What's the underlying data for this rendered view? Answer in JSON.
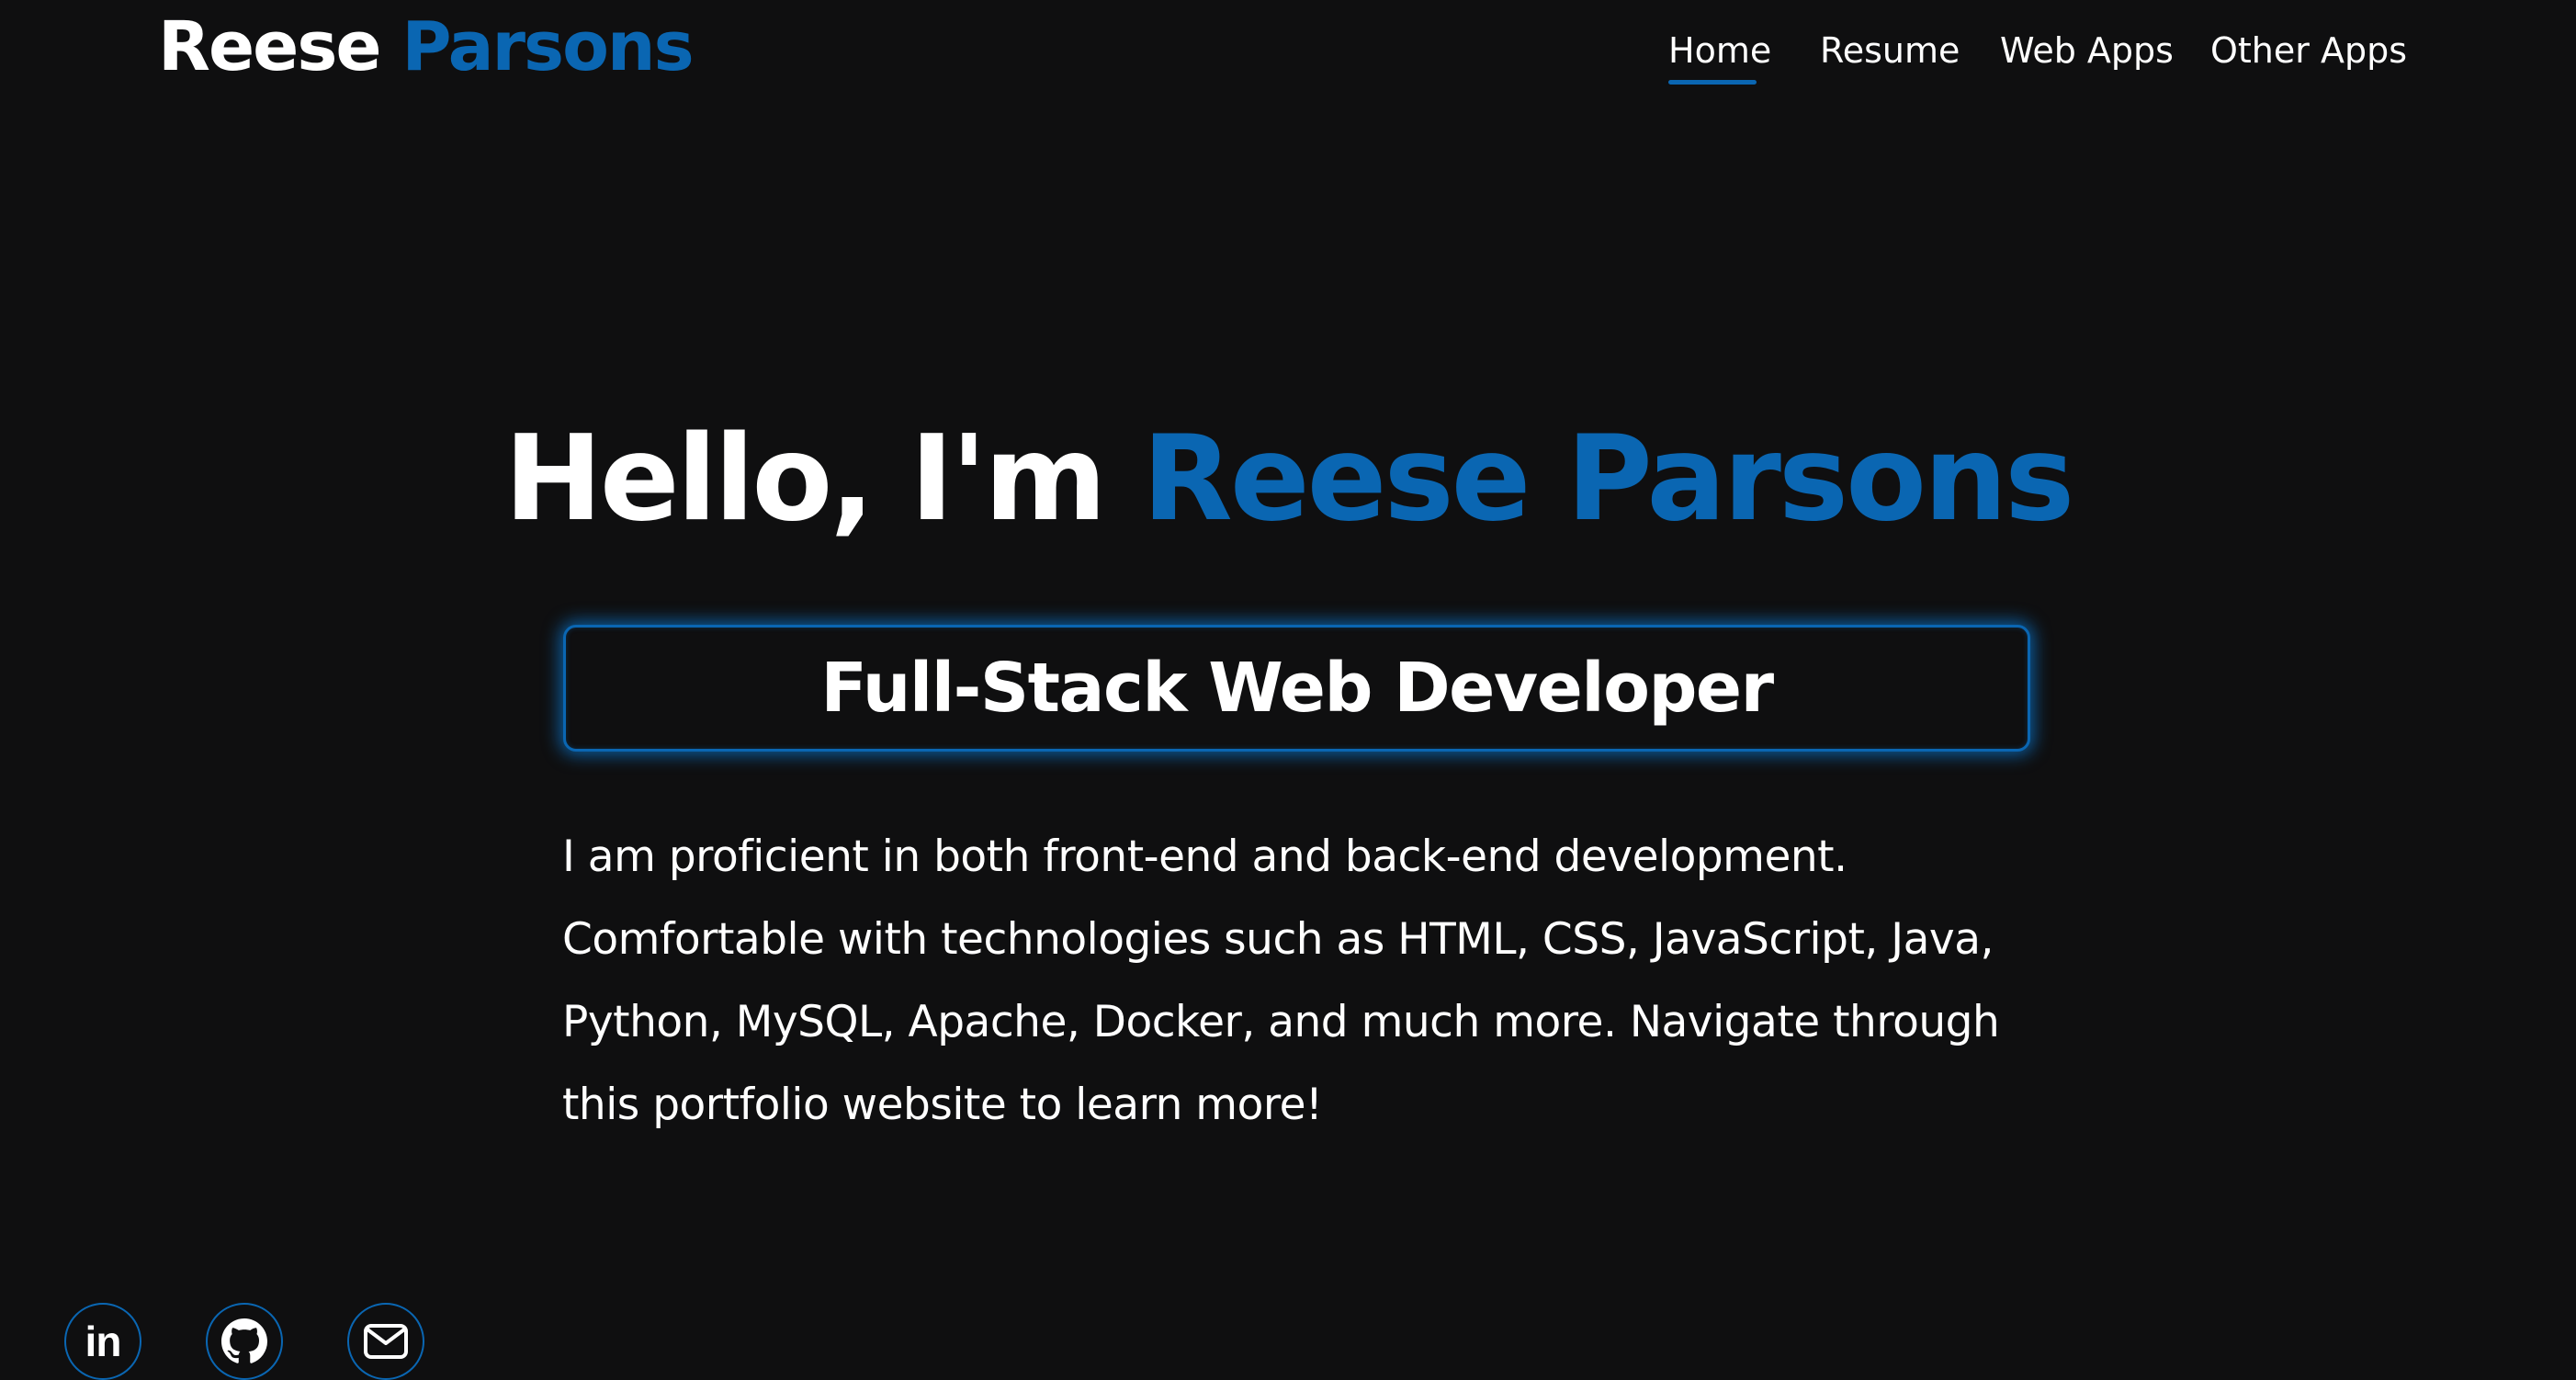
{
  "header": {
    "logo_first": "Reese",
    "logo_last": "Parsons"
  },
  "nav": {
    "items": [
      {
        "label": "Home",
        "active": true
      },
      {
        "label": "Resume",
        "active": false
      },
      {
        "label": "Web Apps",
        "active": false
      },
      {
        "label": "Other Apps",
        "active": false
      }
    ]
  },
  "hero": {
    "greeting": "Hello, I'm",
    "name": "Reese Parsons",
    "role": "Full-Stack Web Developer",
    "bio": "I am proficient in both front-end and back-end development. Comfortable with technologies such as HTML, CSS, JavaScript, Java, Python, MySQL, Apache, Docker, and much more. Navigate through this portfolio website to learn more!"
  },
  "socials": {
    "linkedin_label": "in",
    "icons": [
      "linkedin-icon",
      "github-icon",
      "mail-icon"
    ]
  },
  "colors": {
    "background": "#0f0f10",
    "accent": "#0a66b2",
    "text": "#ffffff"
  }
}
